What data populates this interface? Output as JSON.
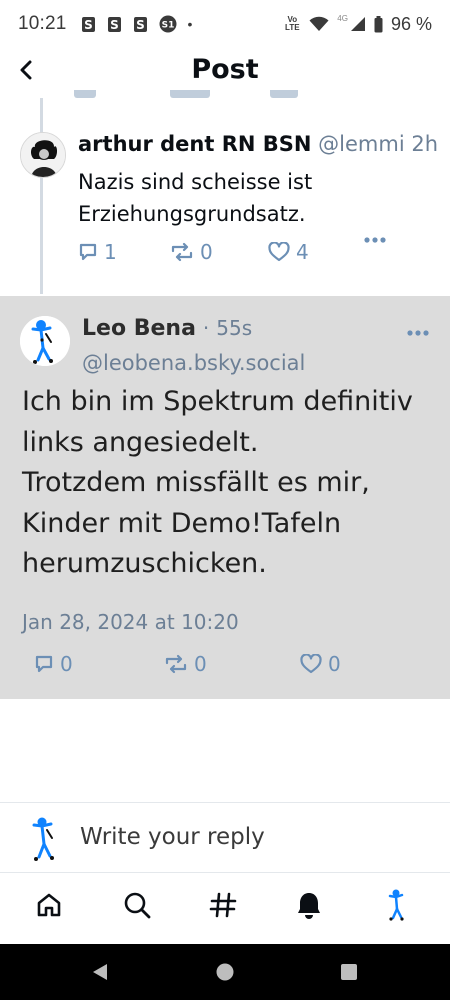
{
  "status_bar": {
    "time": "10:21",
    "notification_icons": [
      "s-app-icon",
      "s-app-icon",
      "s-app-icon",
      "s1-app-icon"
    ],
    "dot": "•",
    "network": "4G",
    "volte": "Vo LTE",
    "battery": "96 %"
  },
  "header": {
    "title": "Post"
  },
  "parent_post": {
    "author_name": "arthur dent RN BSN",
    "handle": "@lemmi…",
    "time": "2h",
    "text": "Nazis sind scheisse ist Erziehungsgrundsatz.",
    "replies": "1",
    "reposts": "0",
    "likes": "4"
  },
  "focused_post": {
    "author_name": "Leo Bena",
    "separator": "·",
    "time": "55s",
    "handle": "@leobena.bsky.social",
    "text_lines": [
      "Ich bin im Spektrum definitiv links angesiedelt.",
      "Trotzdem missfällt es mir, Kinder mit Demo!Tafeln herumzuschicken."
    ],
    "date": "Jan 28, 2024 at 10:20",
    "replies": "0",
    "reposts": "0",
    "likes": "0"
  },
  "reply_box": {
    "placeholder": "Write your reply"
  },
  "bottom_nav": [
    "home-icon",
    "search-icon",
    "feeds-hash-icon",
    "notifications-bell-icon",
    "profile-avatar-icon"
  ],
  "colors": {
    "accent": "#1083fe",
    "muted": "#6c7f95",
    "action": "#6c8fb5",
    "focus_bg": "#dcdcdc"
  }
}
